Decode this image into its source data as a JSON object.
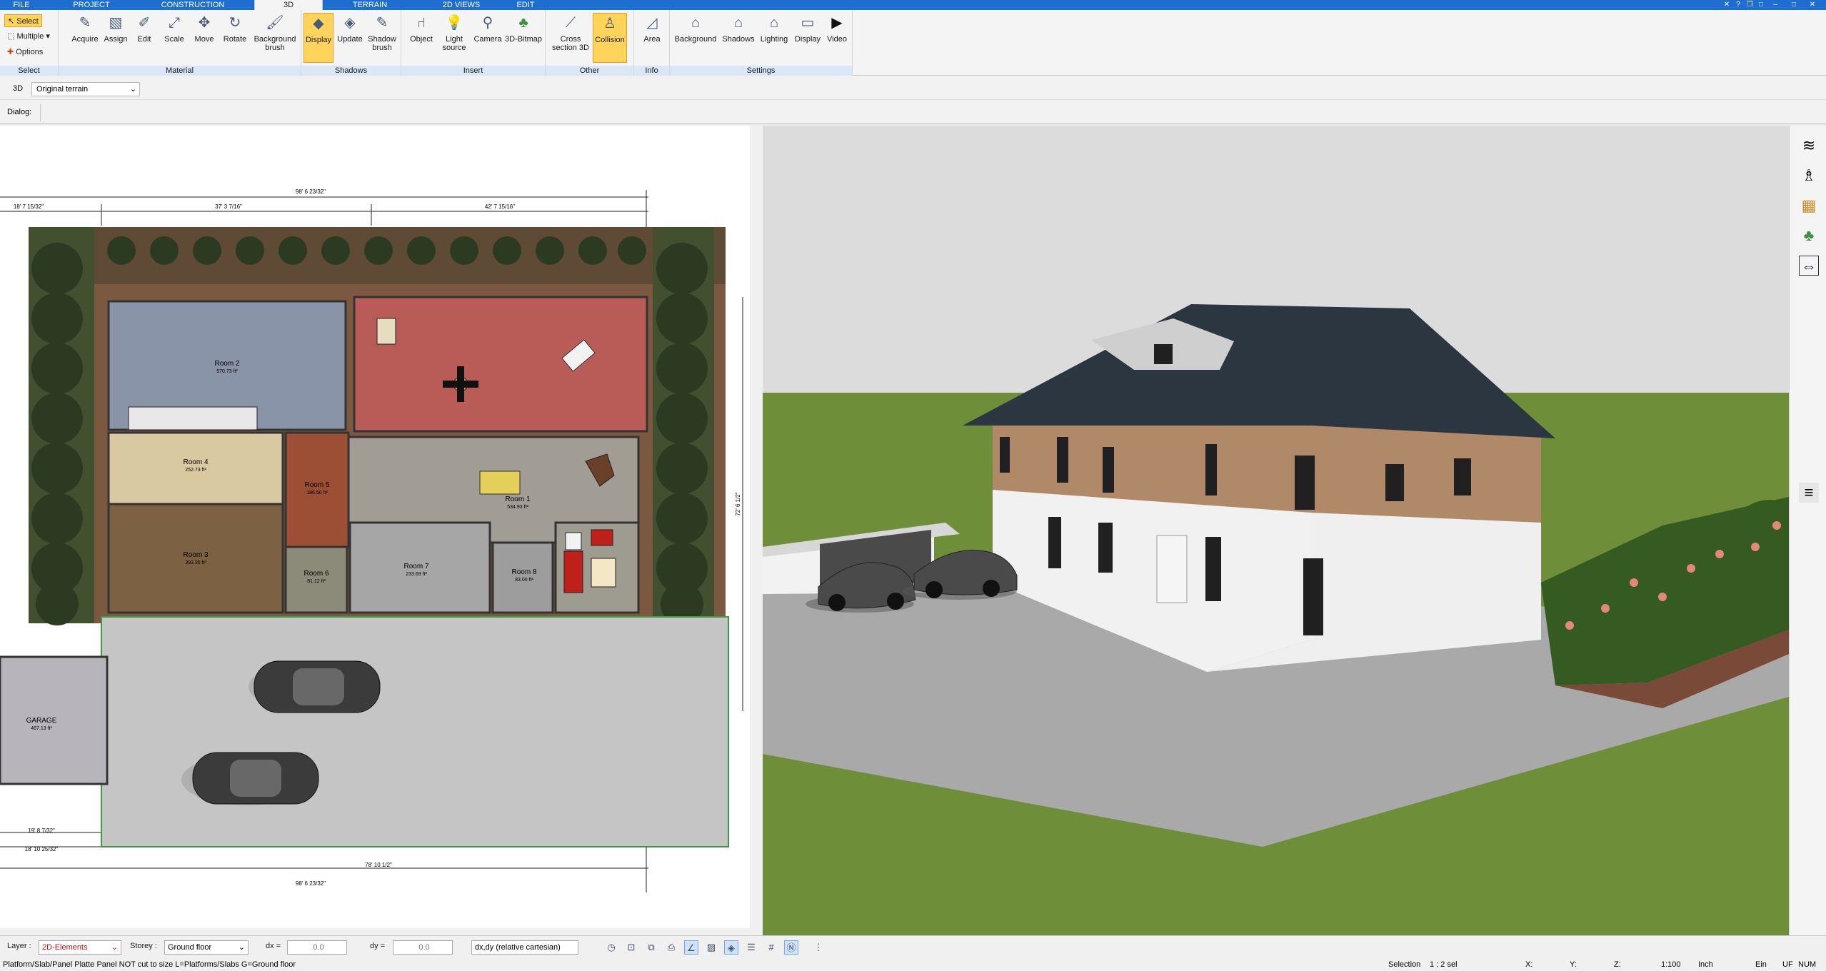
{
  "menu": {
    "tabs": [
      "FILE",
      "PROJECT",
      "CONSTRUCTION",
      "3D",
      "TERRAIN",
      "2D VIEWS",
      "EDIT"
    ],
    "active": "3D"
  },
  "ribbon": {
    "select_group": {
      "select": "Select",
      "multiple": "Multiple",
      "options": "Options",
      "label": "Select"
    },
    "material": {
      "label": "Material",
      "buttons": [
        "Acquire",
        "Assign",
        "Edit",
        "Scale",
        "Move",
        "Rotate",
        "Background brush"
      ]
    },
    "shadows": {
      "label": "Shadows",
      "buttons": [
        "Display",
        "Update",
        "Shadow brush"
      ]
    },
    "insert": {
      "label": "Insert",
      "buttons": [
        "Object",
        "Light source",
        "Camera",
        "3D-Bitmap"
      ]
    },
    "other": {
      "label": "Other",
      "buttons": [
        "Cross section 3D",
        "Collision"
      ]
    },
    "info": {
      "label": "Info",
      "buttons": [
        "Area"
      ]
    },
    "settings": {
      "label": "Settings",
      "buttons": [
        "Background",
        "Shadows",
        "Lighting",
        "Display",
        "Video"
      ]
    }
  },
  "toolbar": {
    "mode": "3D",
    "terrain": "Original terrain",
    "dialog_label": "Dialog:"
  },
  "plan": {
    "rooms": [
      {
        "name": "Room 2",
        "area": "570.73 ft²"
      },
      {
        "name": "Room 4",
        "area": "252.73 ft²"
      },
      {
        "name": "Room 3",
        "area": "393.35 ft²"
      },
      {
        "name": "Room 5",
        "area": "186.50 ft²"
      },
      {
        "name": "Room 1",
        "area": "534.93 ft²"
      },
      {
        "name": "Room 6",
        "area": "81.12 ft²"
      },
      {
        "name": "Room 7",
        "area": "233.69 ft²"
      },
      {
        "name": "Room 8",
        "area": "83.00 ft²"
      },
      {
        "name": "GARAGE",
        "area": "467.13 ft²"
      }
    ],
    "dims": {
      "top_total": "98' 6 23/32\"",
      "top_a": "37' 3 7/16\"",
      "top_b": "42' 7 15/16\"",
      "top_left": "18' 7 15/32\"",
      "bottom_total": "98' 6 23/32\"",
      "bottom_b": "78' 10 1/2\"",
      "bottom_left": "19' 8 7/32\"",
      "left_small": "18' 10 25/32\"",
      "right_total": "72' 6 1/2\""
    }
  },
  "statusbar": {
    "layer_label": "Layer :",
    "layer_value": "2D-Elements",
    "storey_label": "Storey :",
    "storey_value": "Ground floor",
    "dx_label": "dx =",
    "dx_value": "0.0",
    "dy_label": "dy =",
    "dy_value": "0.0",
    "coord_mode": "dx,dy (relative cartesian)"
  },
  "hintbar": {
    "message": "Platform/Slab/Panel Platte Panel NOT cut to size L=Platforms/Slabs G=Ground floor",
    "selection_label": "Selection",
    "selection_value": "1 : 2 sel",
    "x_label": "X:",
    "y_label": "Y:",
    "z_label": "Z:",
    "scale": "1:100",
    "unit": "Inch",
    "ein": "Ein",
    "uf": "UF",
    "num": "NUM"
  },
  "colors": {
    "menubar": "#1e6ecf",
    "group_label": "#dbe6f6",
    "active_button": "#ffd35c",
    "sky": "#dcdcdc",
    "lawn": "#6e8e3a",
    "roof": "#2b3640",
    "wood": "#b08a68",
    "paving": "#a9a9a9"
  }
}
